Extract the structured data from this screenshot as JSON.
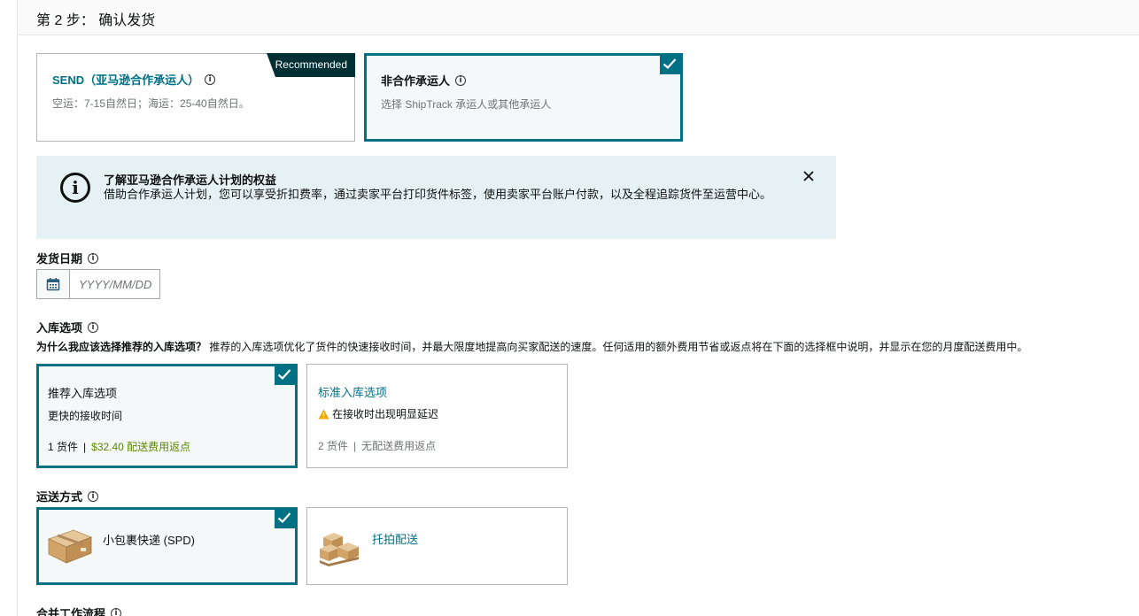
{
  "step": {
    "title": "第 2 步： 确认发货"
  },
  "carrier_options": {
    "send": {
      "title": "SEND（亚马逊合作承运人）",
      "badge": "Recommended",
      "subtitle": "空运：7-15自然日；海运：25-40自然日。",
      "selected": false
    },
    "non_partnered": {
      "title": "非合作承运人",
      "subtitle": "选择 ShipTrack 承运人或其他承运人",
      "selected": true
    }
  },
  "banner": {
    "title": "了解亚马逊合作承运人计划的权益",
    "body": "借助合作承运人计划，您可以享受折扣费率，通过卖家平台打印货件标签，使用卖家平台账户付款，以及全程追踪货件至运营中心。"
  },
  "ship_date": {
    "label": "发货日期",
    "placeholder": "YYYY/MM/DD",
    "value": ""
  },
  "inbound": {
    "label": "入库选项",
    "why_bold": "为什么我应该选择推荐的入库选项？",
    "why_text": "推荐的入库选项优化了货件的快速接收时间，并最大限度地提高向买家配送的速度。任何适用的额外费用节省或返点将在下面的选择框中说明，并显示在您的月度配送费用中。",
    "options": [
      {
        "title": "推荐入库选项",
        "line2": "更快的接收时间",
        "shipments": "1 货件",
        "separator": "|",
        "fee": "$32.40 配送费用返点",
        "selected": true
      },
      {
        "title": "标准入库选项",
        "line2": "在接收时出现明显延迟",
        "shipments": "2 货件",
        "separator": "|",
        "fee": "无配送费用返点",
        "selected": false
      }
    ]
  },
  "shipping_method": {
    "label": "运送方式",
    "options": [
      {
        "label": "小包裹快递 (SPD)",
        "icon": "box-icon",
        "selected": true
      },
      {
        "label": "托拍配送",
        "icon": "pallet-icon",
        "selected": false
      }
    ]
  },
  "workflow": {
    "label": "合并工作流程"
  },
  "colors": {
    "accent": "#007185",
    "badge_bg": "#002f36",
    "banner_bg": "#e6f1f3",
    "rebate_green": "#5b8700",
    "warning": "#f0a800"
  }
}
